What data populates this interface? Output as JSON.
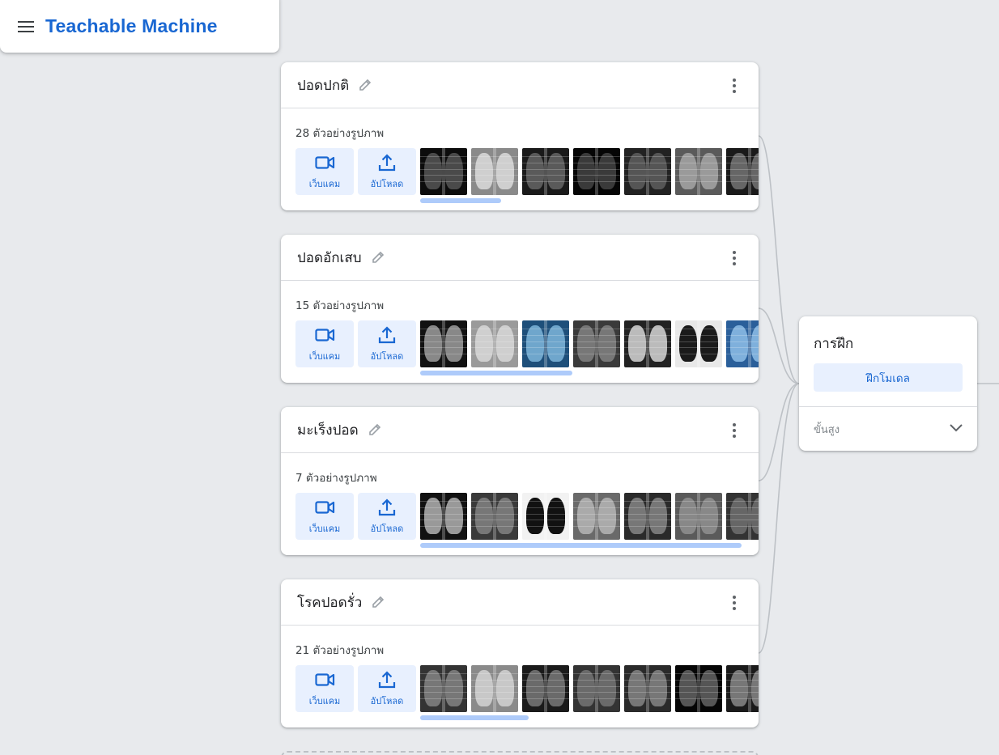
{
  "header": {
    "app_title": "Teachable Machine",
    "menu_icon": "hamburger-menu-icon"
  },
  "classes": [
    {
      "name": "ปอดปกติ",
      "count_label": "28 ตัวอย่างรูปภาพ",
      "webcam_label": "เว็บแคม",
      "upload_label": "อัปโหลด",
      "scroll_fraction": 0.24,
      "thumb_style": "normal"
    },
    {
      "name": "ปอดอักเสบ",
      "count_label": "15 ตัวอย่างรูปภาพ",
      "webcam_label": "เว็บแคม",
      "upload_label": "อัปโหลด",
      "scroll_fraction": 0.45,
      "thumb_style": "pneumonia"
    },
    {
      "name": "มะเร็งปอด",
      "count_label": "7 ตัวอย่างรูปภาพ",
      "webcam_label": "เว็บแคม",
      "upload_label": "อัปโหลด",
      "scroll_fraction": 0.95,
      "thumb_style": "cancer"
    },
    {
      "name": "โรคปอดรั่ว",
      "count_label": "21 ตัวอย่างรูปภาพ",
      "webcam_label": "เว็บแคม",
      "upload_label": "อัปโหลด",
      "scroll_fraction": 0.32,
      "thumb_style": "pneumothorax"
    }
  ],
  "training": {
    "title": "การฝึก",
    "train_button": "ฝึกโมเดล",
    "advanced_label": "ขั้นสูง"
  },
  "colors": {
    "accent": "#1967d2",
    "tile_bg": "#e8f0fe",
    "scrollbar": "#aecbfa",
    "background": "#e8eaed"
  }
}
